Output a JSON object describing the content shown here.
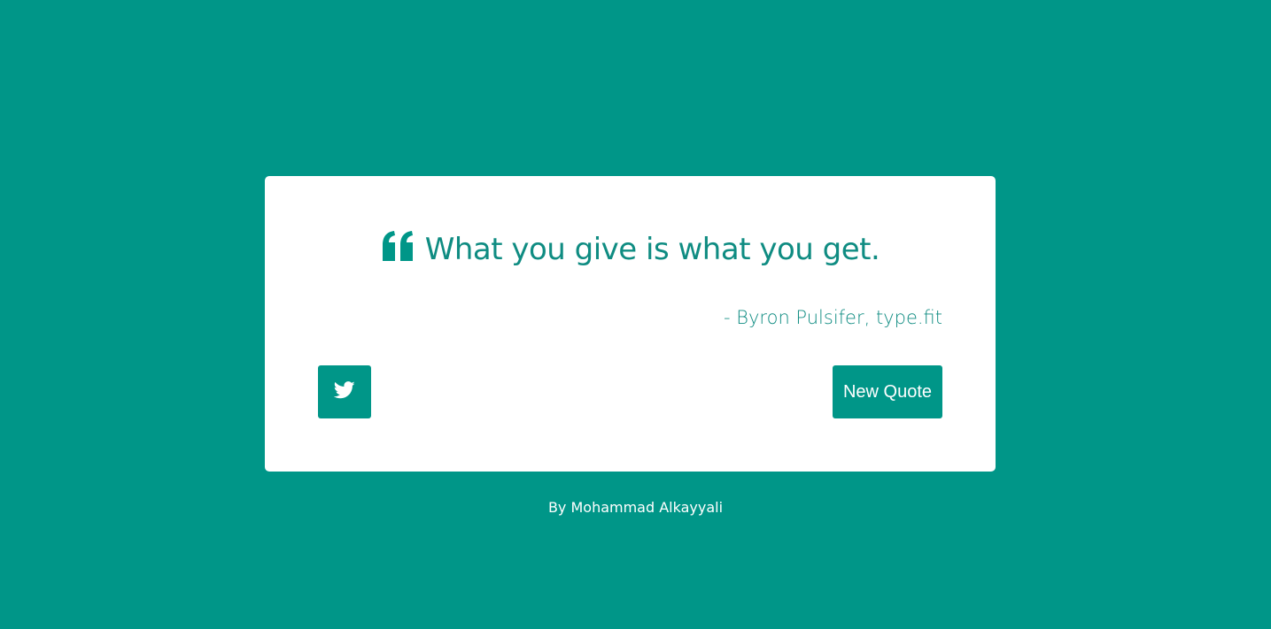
{
  "quote": {
    "icon": "quote-left-icon",
    "text": "What you give is what you get.",
    "author": "- Byron Pulsifer, type.fit"
  },
  "actions": {
    "tweet_icon": "twitter-icon",
    "new_quote_label": "New Quote"
  },
  "footer": {
    "credit": "By Mohammad Alkayyali"
  },
  "colors": {
    "background": "#009688",
    "card": "#ffffff",
    "accent": "#009688"
  }
}
